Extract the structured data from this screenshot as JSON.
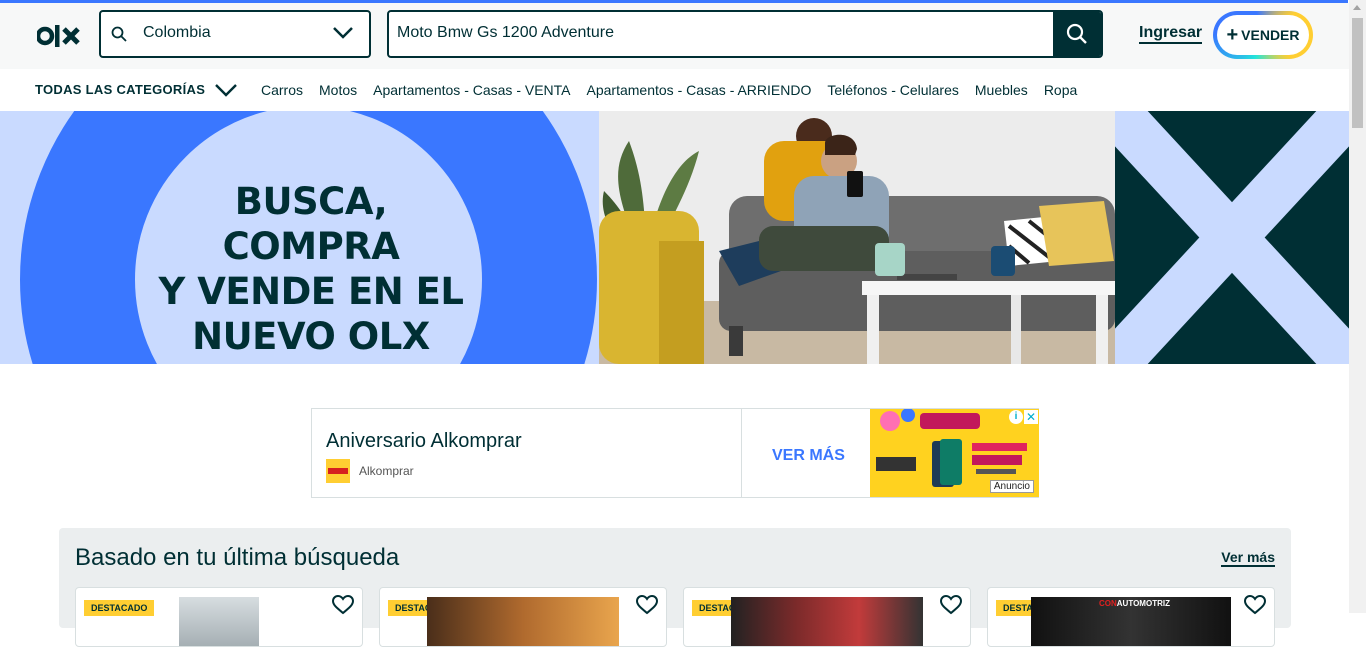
{
  "header": {
    "location_value": "Colombia",
    "search_value": "Moto Bmw Gs 1200 Adventure",
    "login_label": "Ingresar",
    "sell_label": "VENDER"
  },
  "nav": {
    "all_categories_label": "TODAS LAS CATEGORÍAS",
    "categories": [
      "Carros",
      "Motos",
      "Apartamentos - Casas - VENTA",
      "Apartamentos - Casas - ARRIENDO",
      "Teléfonos - Celulares",
      "Muebles",
      "Ropa"
    ]
  },
  "hero": {
    "line1": "BUSCA, COMPRA",
    "line2": "Y VENDE EN EL",
    "line3": "NUEVO OLX"
  },
  "ad": {
    "title": "Aniversario Alkomprar",
    "brand": "Alkomprar",
    "cta": "VER MÁS",
    "tag": "Anuncio"
  },
  "section": {
    "title": "Basado en tu última búsqueda",
    "more_label": "Ver más",
    "cards": [
      {
        "badge": "DESTACADO"
      },
      {
        "badge": "DESTACADO"
      },
      {
        "badge": "DESTACADO"
      },
      {
        "badge": "DESTACADO"
      }
    ]
  },
  "colors": {
    "primary": "#002f34",
    "accent_blue": "#3a77ff",
    "light_blue": "#c9daff",
    "yellow": "#ffce32",
    "teal": "#23e5db"
  }
}
